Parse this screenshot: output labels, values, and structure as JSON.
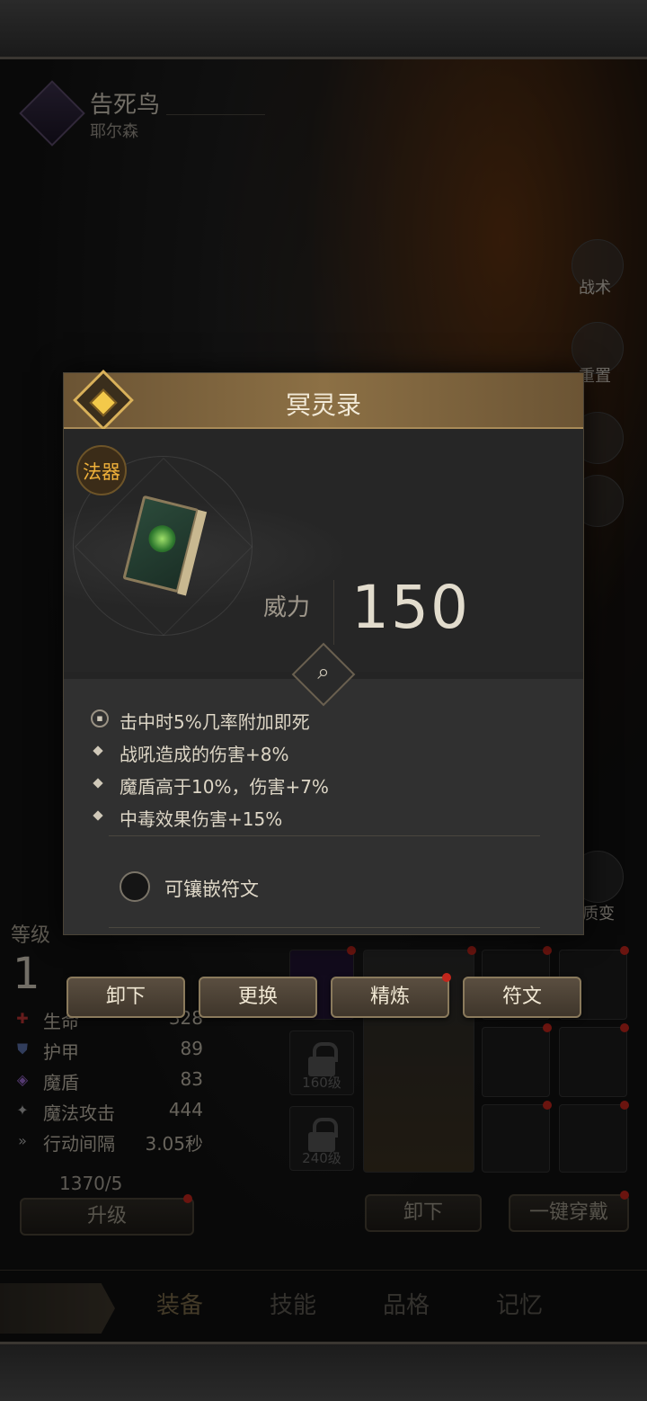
{
  "hero": {
    "name": "告死鸟",
    "subtitle": "耶尔森"
  },
  "side_buttons": {
    "tactics": "战术",
    "reset": "重置",
    "transmute": "质变"
  },
  "level": {
    "label": "等级",
    "value": "1"
  },
  "stats": [
    {
      "icon": "health-icon",
      "name": "生命",
      "value": "328"
    },
    {
      "icon": "armor-icon",
      "name": "护甲",
      "value": "89"
    },
    {
      "icon": "magic-shield-icon",
      "name": "魔盾",
      "value": "83"
    },
    {
      "icon": "magic-attack-icon",
      "name": "魔法攻击",
      "value": "444"
    },
    {
      "icon": "action-interval-icon",
      "name": "行动间隔",
      "value": "3.05秒"
    }
  ],
  "soul_currency": "1370/5",
  "buttons": {
    "upgrade": "升级",
    "unequip_all": "卸下",
    "one_click_equip": "一键穿戴"
  },
  "slots": {
    "lock_160": "160级",
    "lock_240": "240级"
  },
  "nav": {
    "tabs": [
      "装备",
      "技能",
      "品格",
      "记忆"
    ]
  },
  "modal": {
    "title": "冥灵录",
    "item_type": "法器",
    "stat_name": "威力",
    "stat_value": "150",
    "effects": [
      "击中时5%几率附加即死",
      "战吼造成的伤害+8%",
      "魔盾高于10%，伤害+7%",
      "中毒效果伤害+15%"
    ],
    "socket_label": "可镶嵌符文",
    "actions": {
      "unequip": "卸下",
      "replace": "更换",
      "refine": "精炼",
      "rune": "符文"
    }
  },
  "colors": {
    "accent_gold": "#d9b15a",
    "type_orange": "#f0b13a",
    "notify_red": "#c2261c"
  }
}
